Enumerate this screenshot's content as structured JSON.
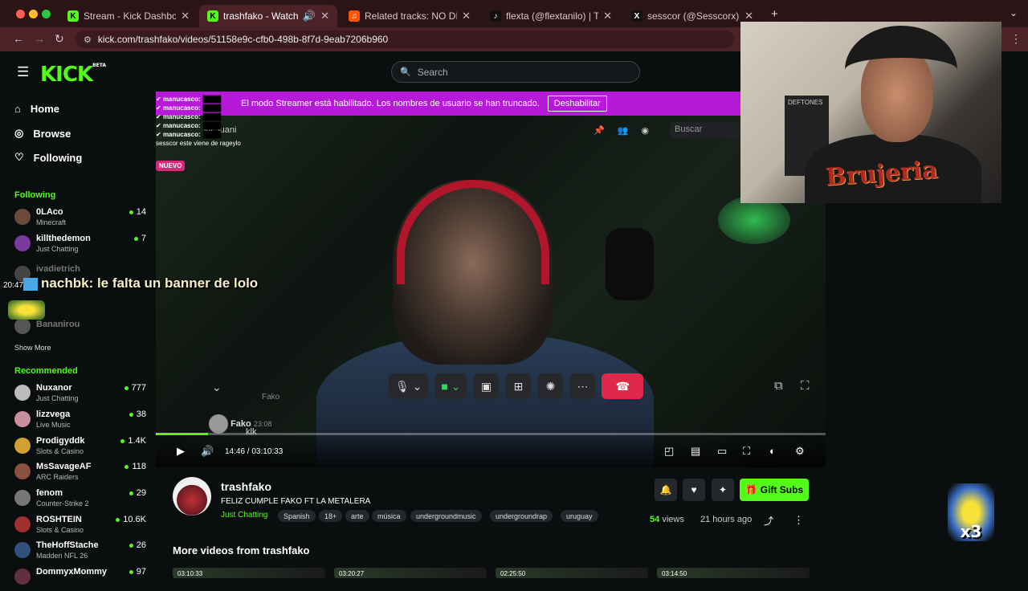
{
  "browser": {
    "tabs": [
      {
        "title": "Stream - Kick Dashboard",
        "icon": "K",
        "color": "#53fc18"
      },
      {
        "title": "trashfako - Watch the VO",
        "icon": "K",
        "color": "#53fc18"
      },
      {
        "title": "Related tracks: NO DIGAS MA",
        "icon": "♫",
        "color": "#ff5500"
      },
      {
        "title": "flexta (@flextanilo) | TikTok",
        "icon": "♪",
        "color": "#111111"
      },
      {
        "title": "sesscor (@Sesscorx) / X",
        "icon": "X",
        "color": "#111111"
      }
    ],
    "url": "kick.com/trashfako/videos/51158e9c-cfb0-498b-8f7d-9eab7206b960"
  },
  "header": {
    "logo": "KICK",
    "logo_beta": "BETA",
    "search_placeholder": "Search"
  },
  "sidebar": {
    "nav": [
      {
        "label": "Home",
        "icon": "home-icon"
      },
      {
        "label": "Browse",
        "icon": "compass-icon"
      },
      {
        "label": "Following",
        "icon": "heart-icon"
      }
    ],
    "following_title": "Following",
    "following": [
      {
        "name": "0LAco",
        "category": "Minecraft",
        "viewers": "14"
      },
      {
        "name": "killthedemon",
        "category": "Just Chatting",
        "viewers": "7"
      },
      {
        "name": "ivadietrich",
        "category": "",
        "viewers": ""
      },
      {
        "name": "",
        "category": "",
        "viewers": ""
      },
      {
        "name": "Bananirou",
        "category": "",
        "viewers": ""
      }
    ],
    "show_more": "Show More",
    "recommended_title": "Recommended",
    "recommended": [
      {
        "name": "Nuxanor",
        "category": "Just Chatting",
        "viewers": "777"
      },
      {
        "name": "lizzvega",
        "category": "Live Music",
        "viewers": "38"
      },
      {
        "name": "Prodigyddk",
        "category": "Slots & Casino",
        "viewers": "1.4K"
      },
      {
        "name": "MsSavageAF",
        "category": "ARC Raiders",
        "viewers": "118"
      },
      {
        "name": "fenom",
        "category": "Counter-Strike 2",
        "viewers": "29"
      },
      {
        "name": "ROSHTEIN",
        "category": "Slots & Casino",
        "viewers": "10.6K"
      },
      {
        "name": "TheHoffStache",
        "category": "Madden NFL 26",
        "viewers": "26"
      },
      {
        "name": "DommyxMommy",
        "category": "",
        "viewers": "97"
      }
    ]
  },
  "video": {
    "streamer_banner": "El modo Streamer está habilitado. Los nombres de usuario se han truncado.",
    "streamer_banner_button": "Deshabilitar",
    "discord_user": "juani",
    "discord_search": "Buscar",
    "chat_lines": [
      "manucasco:",
      "manucasco:",
      "manucasco:",
      "manucasco:",
      "manucasco:"
    ],
    "chat_line_sesscor": "sesscor este viene de rageylo",
    "new_badge": "NUEVO",
    "fako_label": "Fako",
    "fako_name": "Fako",
    "fako_time": "23:08",
    "fako_msg": "klk",
    "time_current": "14:46",
    "time_total": "03:10:33",
    "progress": 0.078
  },
  "overlay_chat": {
    "timestamp": "20:47",
    "user": "nachbk",
    "message": ": le falta un banner de lolo"
  },
  "webcam": {
    "shirt_text": "Brujeria",
    "poster_text": "DEFTONES"
  },
  "channel": {
    "name": "trashfako",
    "title": "FELIZ CUMPLE FAKO FT LA METALERA",
    "category": "Just Chatting",
    "tags": [
      "Spanish",
      "18+",
      "arte",
      "música",
      "undergroundmusic",
      "undergroundrap",
      "uruguay"
    ],
    "gift_label": "Gift Subs",
    "views_count": "54",
    "views_label": "views",
    "ago": "21 hours ago"
  },
  "more_videos": {
    "title": "More videos from trashfako",
    "durations": [
      "03:10:33",
      "03:20:27",
      "02:25:50",
      "03:14:50"
    ]
  },
  "emote_counter": "x3"
}
